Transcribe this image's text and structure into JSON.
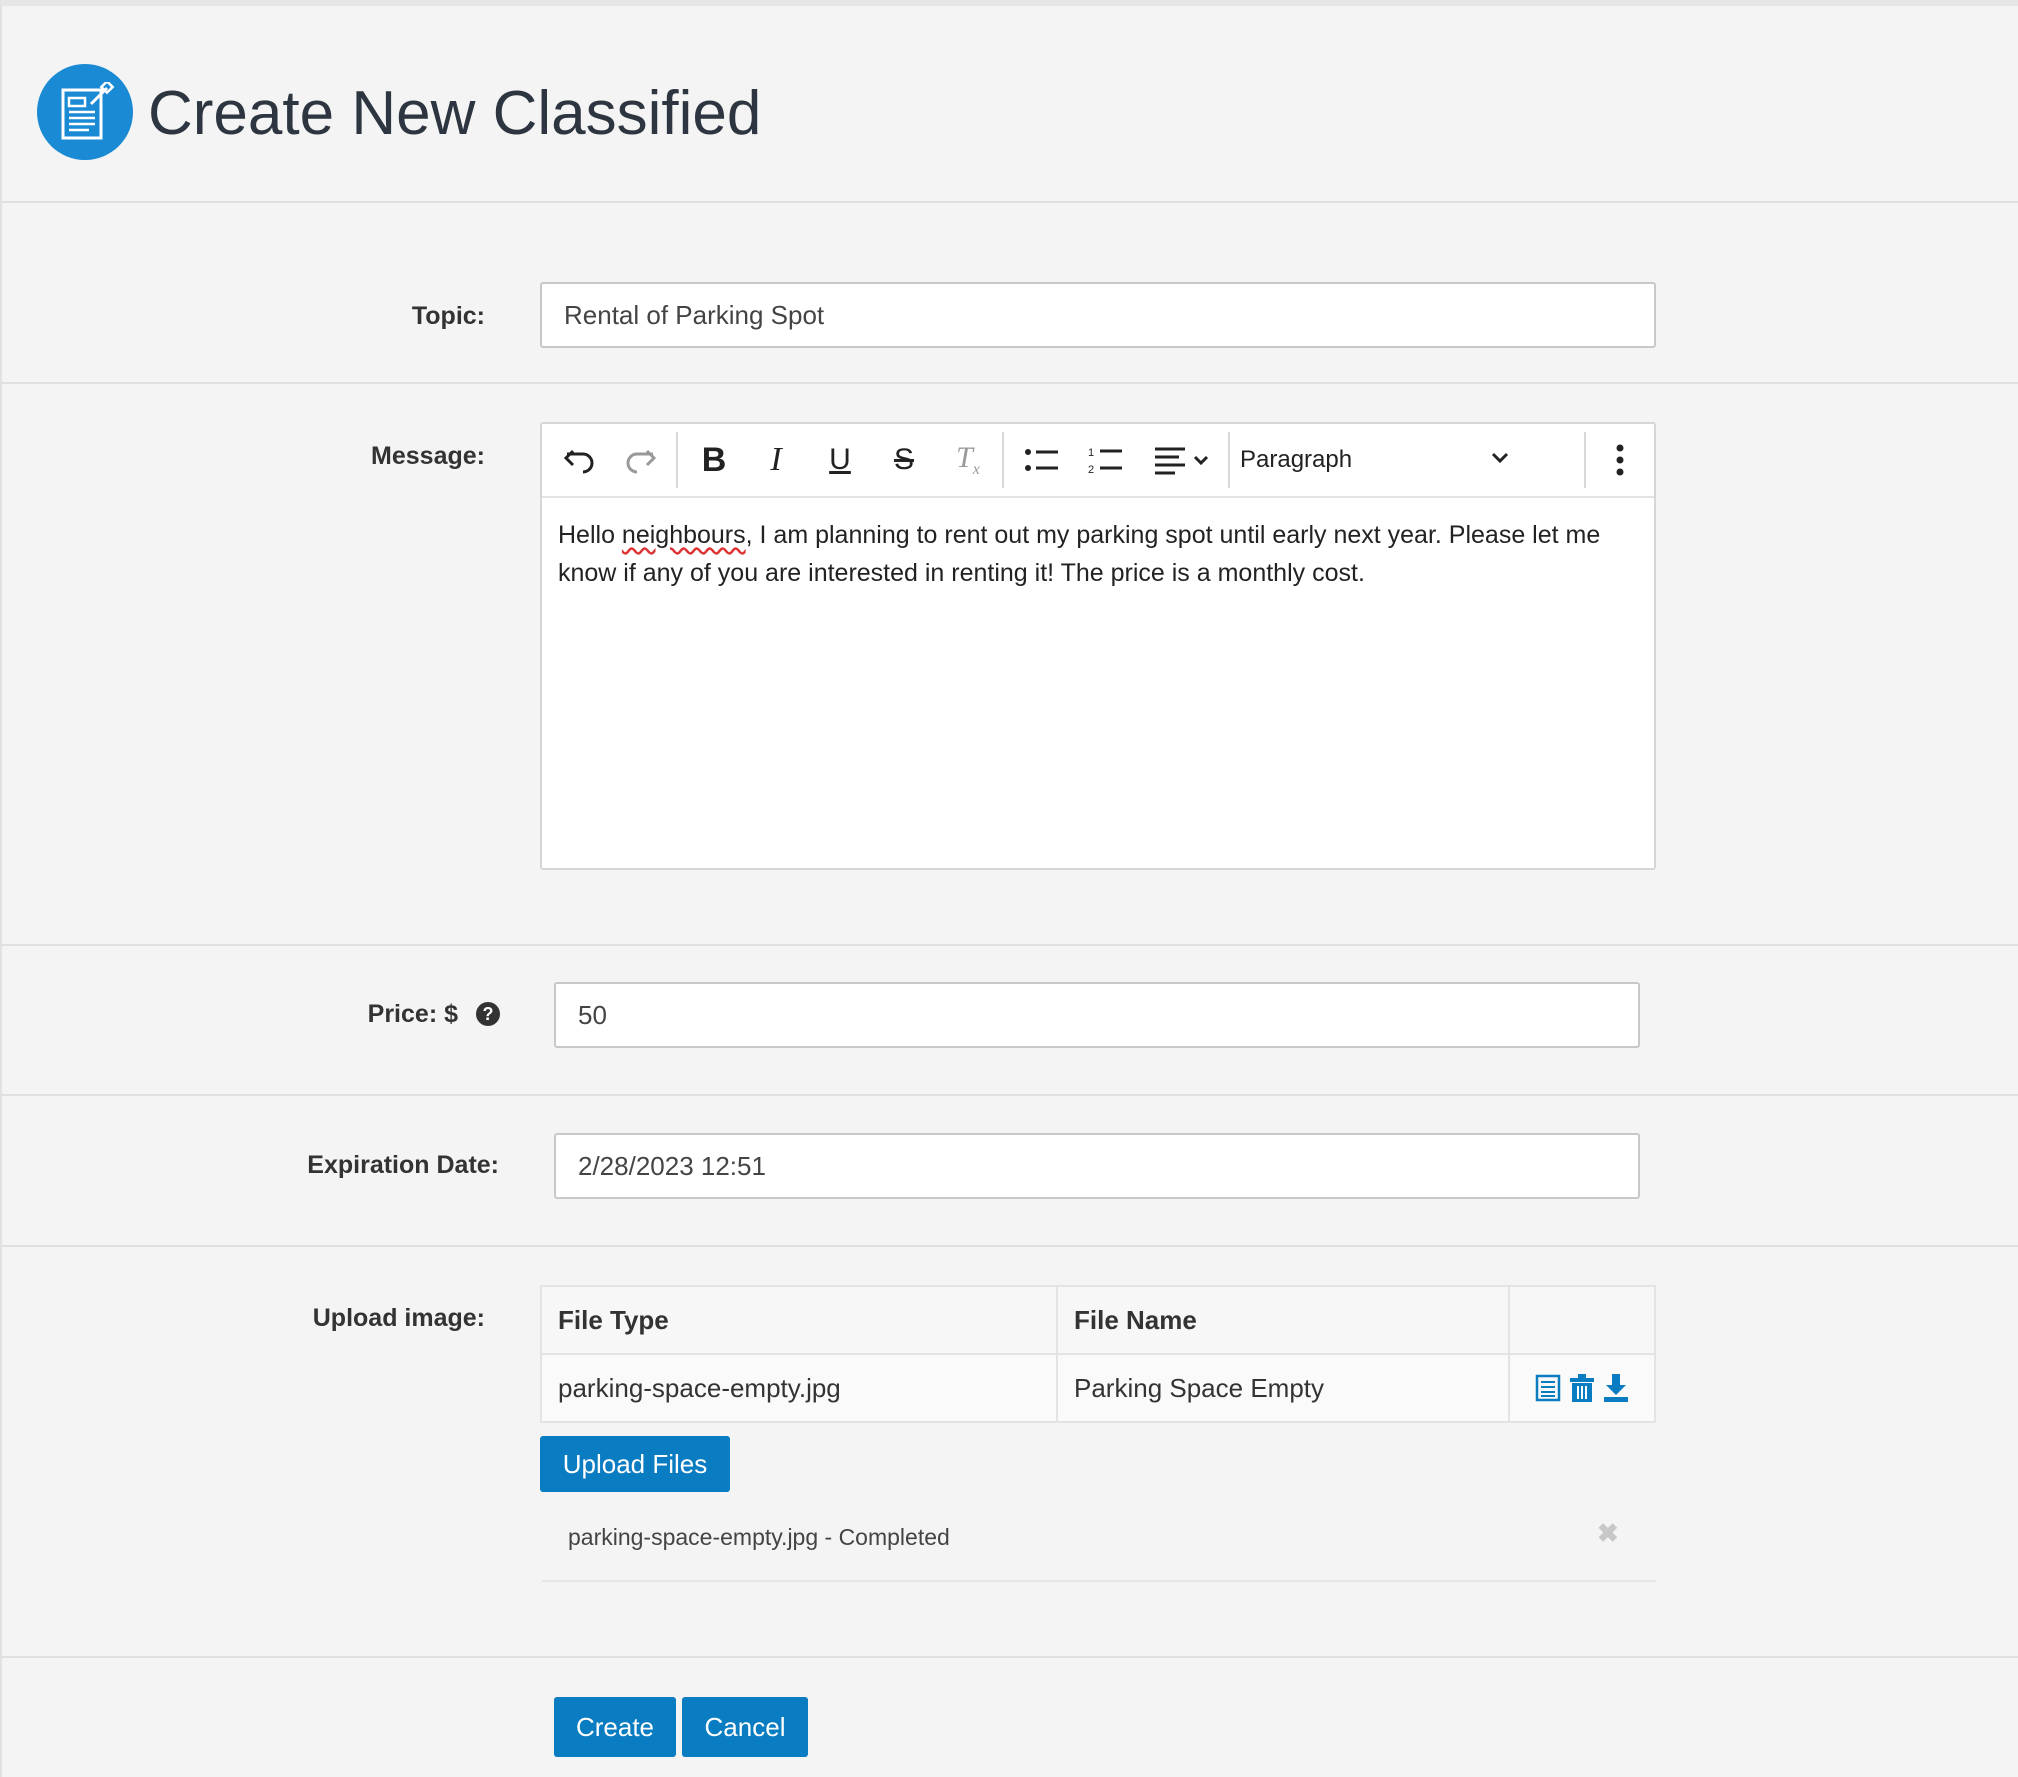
{
  "header": {
    "title": "Create New Classified",
    "icon": "classified-document-icon",
    "accent": "#1a8ad4"
  },
  "topic": {
    "label": "Topic:",
    "value": "Rental of Parking Spot"
  },
  "message": {
    "label": "Message:",
    "toolbar": {
      "undo": "undo-icon",
      "redo": "redo-icon",
      "bold": "bold-icon",
      "italic": "italic-icon",
      "underline": "underline-icon",
      "strikethrough": "strikethrough-icon",
      "clear_format": "clear-format-icon",
      "bullet_list": "bullet-list-icon",
      "numbered_list": "numbered-list-icon",
      "align": "align-left-icon",
      "block_format": "Paragraph",
      "more": "more-vertical-icon"
    },
    "body_part1": "Hello ",
    "body_misspelled": "neighbours",
    "body_part2": ", I am planning to rent out my parking spot until early next year. Please let me know if any of you are interested in renting it! The price is a monthly cost."
  },
  "price": {
    "label": "Price: $",
    "value": "50",
    "help_icon": "question-circle-icon"
  },
  "expiration": {
    "label": "Expiration Date:",
    "value": "2/28/2023 12:51"
  },
  "upload": {
    "label": "Upload image:",
    "columns": [
      "File Type",
      "File Name",
      ""
    ],
    "rows": [
      {
        "file_type": "parking-space-empty.jpg",
        "file_name": "Parking Space Empty"
      }
    ],
    "upload_button": "Upload Files",
    "status_text": "parking-space-empty.jpg - Completed"
  },
  "actions": {
    "create": "Create",
    "cancel": "Cancel",
    "button_color": "#0a7cc1"
  }
}
